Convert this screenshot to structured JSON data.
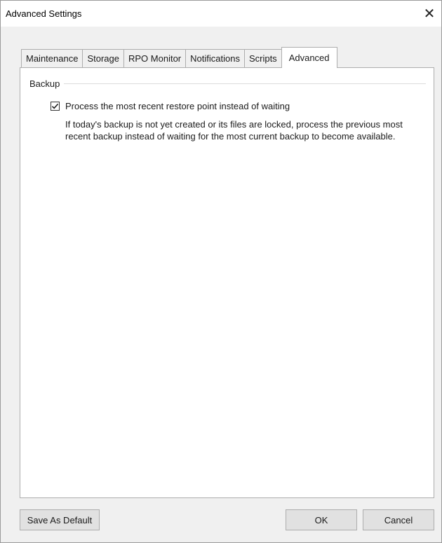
{
  "window": {
    "title": "Advanced Settings",
    "close_glyph": "✕"
  },
  "tabs": [
    {
      "label": "Maintenance",
      "active": false
    },
    {
      "label": "Storage",
      "active": false
    },
    {
      "label": "RPO Monitor",
      "active": false
    },
    {
      "label": "Notifications",
      "active": false
    },
    {
      "label": "Scripts",
      "active": false
    },
    {
      "label": "Advanced",
      "active": true
    }
  ],
  "backup_group": {
    "label": "Backup",
    "checkbox_label": "Process the most recent restore point instead of waiting",
    "checked": true,
    "description": "If today's backup is not yet created or its files are locked, process the previous most recent backup instead of waiting for the most current backup to become available."
  },
  "buttons": {
    "save_default": "Save As Default",
    "ok": "OK",
    "cancel": "Cancel"
  },
  "colors": {
    "dialog_bg": "#f0f0f0",
    "panel_bg": "#ffffff",
    "border": "#adadad"
  },
  "icons": {
    "close": "close-icon",
    "checkmark": "checkmark-icon"
  }
}
